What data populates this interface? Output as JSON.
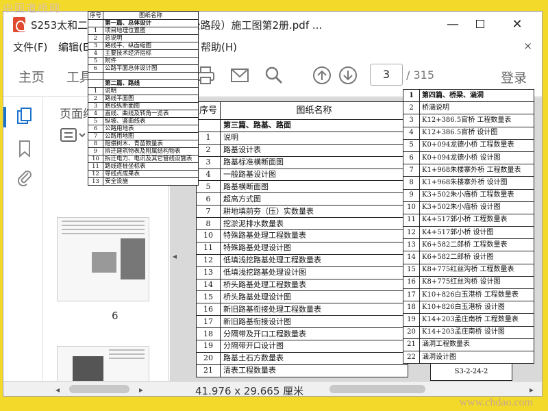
{
  "watermarks": {
    "top": "中国道桥网",
    "bottom": "www.chdao.com"
  },
  "window": {
    "title": "S253太和二龙...段改建工程（二级公路段）施工图第2册.pdf ...",
    "controls": {
      "minimize": "—",
      "close": "✕"
    }
  },
  "menu": {
    "items": [
      "文件(F)",
      "编辑(E)",
      "帮助(H)"
    ],
    "close": "×"
  },
  "toolbar": {
    "tabs": [
      "主页",
      "工具"
    ],
    "login": "登录",
    "current_page": "3",
    "total_pages": "/ 315"
  },
  "thumbnails": {
    "pane_title": "页面缩",
    "page_label": "6"
  },
  "status": {
    "dimensions": "41.976 x 29.665 厘米"
  },
  "doc1": {
    "header": {
      "no": "序号",
      "name": "图纸名称"
    },
    "rows": [
      {
        "no": "",
        "name": "第一篇、总体设计",
        "section": true
      },
      {
        "no": "1",
        "name": "项目地理位置图"
      },
      {
        "no": "2",
        "name": "总说明"
      },
      {
        "no": "3",
        "name": "路线平、纵面缩图"
      },
      {
        "no": "4",
        "name": "主要技术经济指标"
      },
      {
        "no": "5",
        "name": "附件"
      },
      {
        "no": "6",
        "name": "公路平面总体设计图"
      },
      {
        "no": "",
        "name": ""
      },
      {
        "no": "",
        "name": "第二篇、路线",
        "section": true
      },
      {
        "no": "1",
        "name": "说明"
      },
      {
        "no": "2",
        "name": "路线平面图"
      },
      {
        "no": "3",
        "name": "路线纵断面图"
      },
      {
        "no": "4",
        "name": "直线、曲线及转角一览表"
      },
      {
        "no": "5",
        "name": "纵坡、竖曲线表"
      },
      {
        "no": "6",
        "name": "公路用地表"
      },
      {
        "no": "7",
        "name": "公路用地图"
      },
      {
        "no": "8",
        "name": "赔偿树木、青苗数量表"
      },
      {
        "no": "9",
        "name": "拆迁建筑物表及附属结构物表"
      },
      {
        "no": "10",
        "name": "拆迁电力、电讯及其它管线设施表"
      },
      {
        "no": "11",
        "name": "路线逐桩坐标表"
      },
      {
        "no": "12",
        "name": "导线点成果表"
      },
      {
        "no": "13",
        "name": "安全设施"
      }
    ]
  },
  "doc2": {
    "header": {
      "no": "序号",
      "name": "图纸名称"
    },
    "rows": [
      {
        "no": "",
        "name": "第三篇、路基、路面",
        "section": true
      },
      {
        "no": "1",
        "name": "说明"
      },
      {
        "no": "2",
        "name": "路基设计表"
      },
      {
        "no": "3",
        "name": "路基标准横断面图"
      },
      {
        "no": "4",
        "name": "一般路基设计图"
      },
      {
        "no": "5",
        "name": "路基横断面图"
      },
      {
        "no": "6",
        "name": "超高方式图"
      },
      {
        "no": "7",
        "name": "耕地填前夯（压）实数量表"
      },
      {
        "no": "8",
        "name": "挖淤泥排水数量表"
      },
      {
        "no": "10",
        "name": "特殊路基处理工程数量表"
      },
      {
        "no": "11",
        "name": "特殊路基处理设计图"
      },
      {
        "no": "12",
        "name": "低填浅挖路基处理工程数量表"
      },
      {
        "no": "13",
        "name": "低填浅挖路基处理设计图"
      },
      {
        "no": "14",
        "name": "桥头路基处理工程数量表"
      },
      {
        "no": "15",
        "name": "桥头路基处理设计图"
      },
      {
        "no": "16",
        "name": "新旧路基衔接处理工程数量表"
      },
      {
        "no": "17",
        "name": "新旧路基衔接设计图"
      },
      {
        "no": "18",
        "name": "分隔带及开口工程数量表"
      },
      {
        "no": "19",
        "name": "分隔带开口设计图"
      },
      {
        "no": "20",
        "name": "路基土石方数量表"
      },
      {
        "no": "21",
        "name": "清表工程数量表"
      }
    ]
  },
  "doc3": {
    "rows": [
      {
        "no": "1",
        "name": "第四篇、桥梁、涵洞",
        "section": true
      },
      {
        "no": "2",
        "name": "桥涵说明"
      },
      {
        "no": "3",
        "name": "K12+386.5官桥 工程数量表"
      },
      {
        "no": "4",
        "name": "K12+386.5官桥 设计图"
      },
      {
        "no": "5",
        "name": "K0+094龙德小桥 工程数量表"
      },
      {
        "no": "6",
        "name": "K0+094龙德小桥 设计图"
      },
      {
        "no": "7",
        "name": "K1+968朱楼寨外桥 工程数量表"
      },
      {
        "no": "8",
        "name": "K1+968朱楼寨外桥 设计图"
      },
      {
        "no": "9",
        "name": "K3+502朱小庙桥 工程数量表"
      },
      {
        "no": "10",
        "name": "K3+502朱小庙桥 设计图"
      },
      {
        "no": "11",
        "name": "K4+517郭小桥 工程数量表"
      },
      {
        "no": "12",
        "name": "K4+517郭小桥 设计图"
      },
      {
        "no": "13",
        "name": "K6+582二郎桥 工程数量表"
      },
      {
        "no": "14",
        "name": "K6+582二郎桥 设计图"
      },
      {
        "no": "15",
        "name": "K8+775红丝沟桥 工程数量表"
      },
      {
        "no": "16",
        "name": "K8+775红丝沟桥 设计图"
      },
      {
        "no": "17",
        "name": "K10+826白玉港桥 工程数量表"
      },
      {
        "no": "18",
        "name": "K10+826白玉港桥 设计图"
      },
      {
        "no": "19",
        "name": "K14+203孟庄南桥 工程数量表"
      },
      {
        "no": "20",
        "name": "K14+203孟庄南桥 设计图"
      },
      {
        "no": "21",
        "name": "涵洞工程数量表"
      },
      {
        "no": "22",
        "name": "涵洞设计图"
      }
    ],
    "drawing_number": "S3-2-24-2"
  }
}
